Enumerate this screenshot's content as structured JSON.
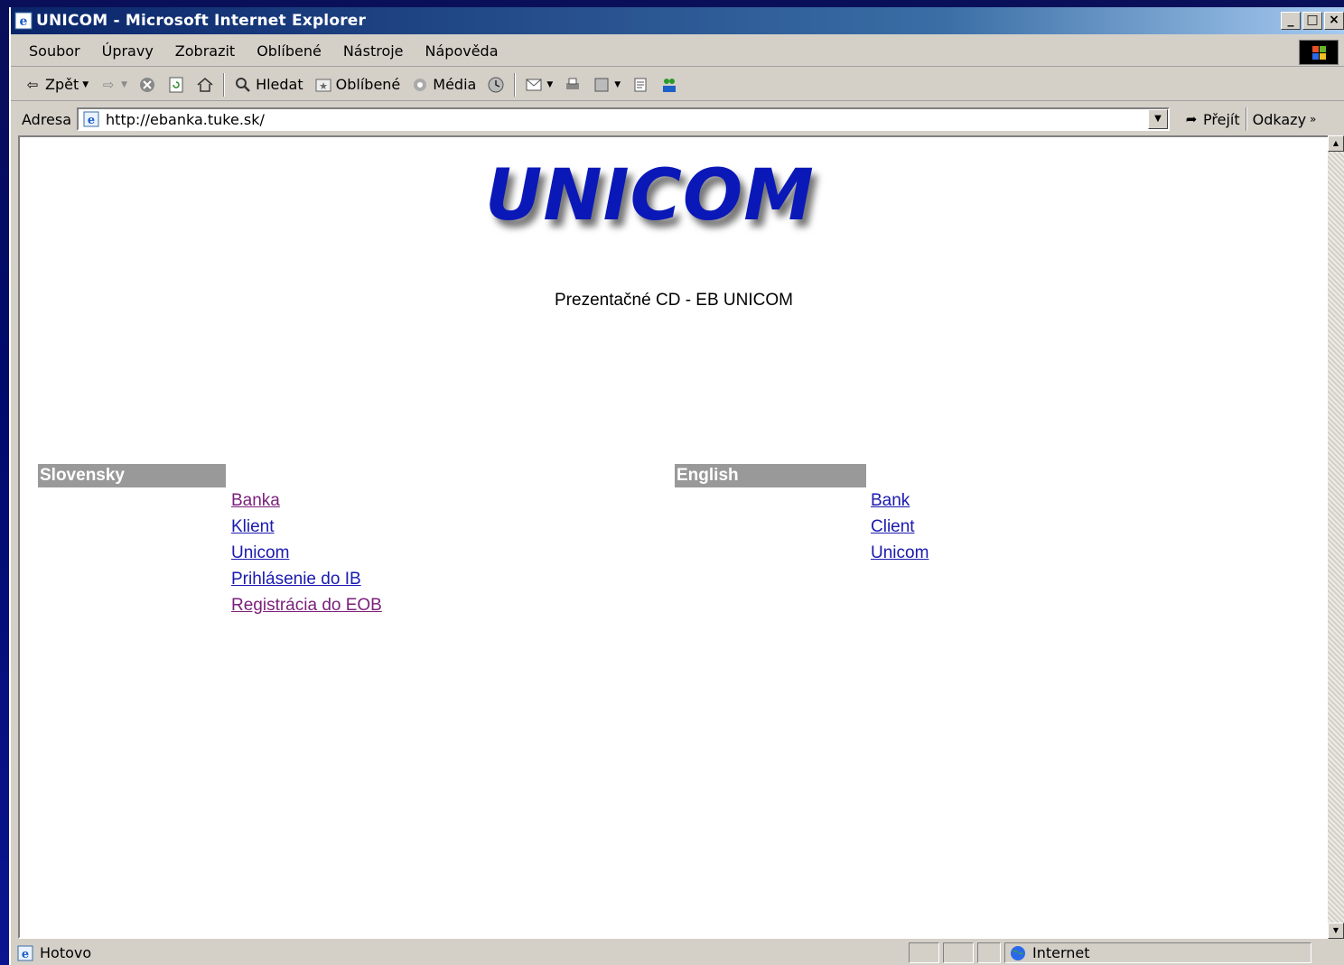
{
  "window": {
    "title": "UNICOM - Microsoft Internet Explorer",
    "btn_minimize": "_",
    "btn_maximize": "□",
    "btn_close": "×"
  },
  "menubar": {
    "items": [
      "Soubor",
      "Úpravy",
      "Zobrazit",
      "Oblíbené",
      "Nástroje",
      "Nápověda"
    ]
  },
  "toolbar": {
    "back_label": "Zpět",
    "search_label": "Hledat",
    "favorites_label": "Oblíbené",
    "media_label": "Média"
  },
  "addressbar": {
    "label": "Adresa",
    "url": "http://ebanka.tuke.sk/",
    "go_label": "Přejít",
    "links_label": "Odkazy"
  },
  "page": {
    "logo": "UNICOM",
    "subtitle": "Prezentačné CD - EB UNICOM",
    "slovak": {
      "header": "Slovensky",
      "links": [
        "Banka",
        "Klient",
        "Unicom",
        "Prihlásenie do IB",
        "Registrácia do EOB"
      ]
    },
    "english": {
      "header": "English",
      "links": [
        "Bank",
        "Client",
        "Unicom"
      ]
    }
  },
  "statusbar": {
    "status": "Hotovo",
    "zone": "Internet"
  },
  "colors": {
    "link": "#1a1ab0",
    "visited_link": "#7a1f7a",
    "logo": "#0a18b8",
    "header_bg": "#999999"
  }
}
